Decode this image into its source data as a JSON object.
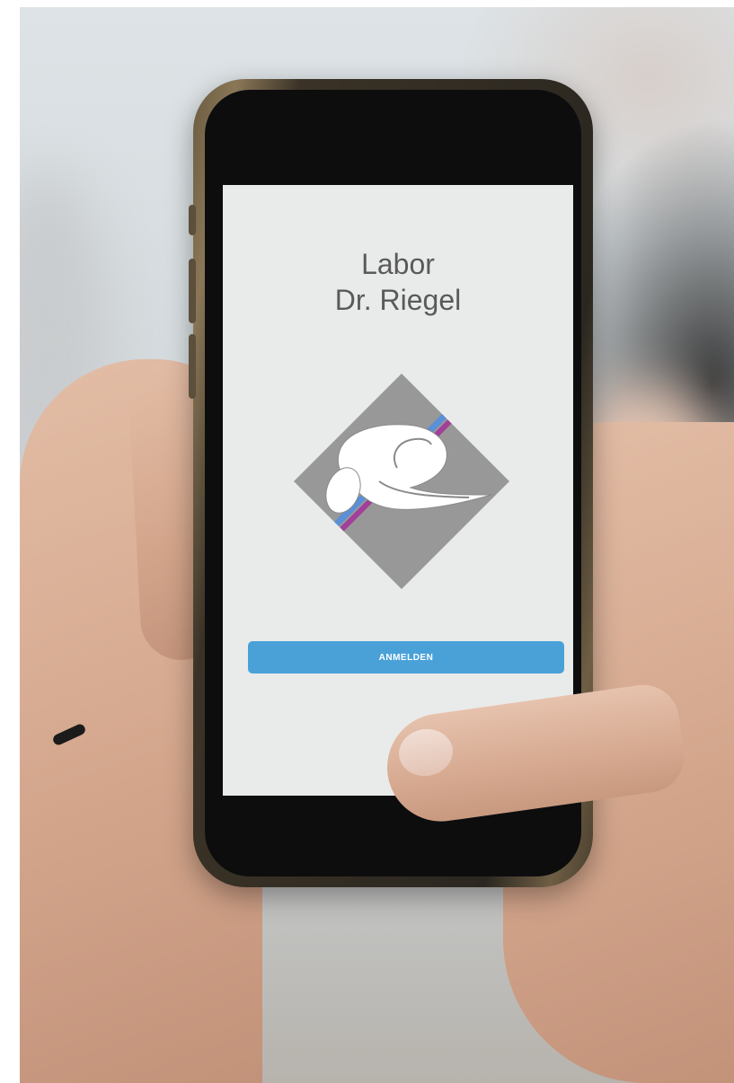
{
  "screen": {
    "title_line1": "Labor",
    "title_line2": "Dr. Riegel",
    "login_button": "ANMELDEN"
  },
  "logo": {
    "icon": "brain-icon",
    "diamond_color": "#989898",
    "stripe_blue": "#5b8fd6",
    "stripe_purple": "#a23f9a"
  },
  "colors": {
    "screen_background": "#e9ebea",
    "title_text": "#5a5a5a",
    "button_background": "#4aa1d8",
    "button_text": "#ffffff"
  }
}
